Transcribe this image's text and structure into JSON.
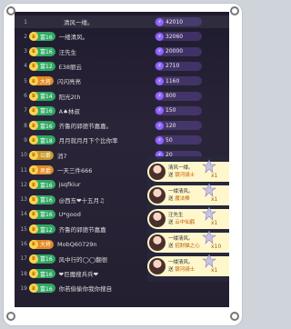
{
  "rows": [
    {
      "rank": "1",
      "badge": "",
      "name": "清风一缕。",
      "score": "42010",
      "type": "none"
    },
    {
      "rank": "2",
      "badge": "富16",
      "name": "一缕清风。",
      "score": "32060",
      "type": "green"
    },
    {
      "rank": "3",
      "badge": "富16",
      "name": "汪先生",
      "score": "20000",
      "type": "green"
    },
    {
      "rank": "4",
      "badge": "富12",
      "name": "E38丽云",
      "score": "2710",
      "type": "green"
    },
    {
      "rank": "5",
      "badge": "大将",
      "name": "闪闪亮亮",
      "score": "1160",
      "type": "orange"
    },
    {
      "rank": "6",
      "badge": "富14",
      "name": "阳光2th",
      "score": "800",
      "type": "green"
    },
    {
      "rank": "7",
      "badge": "富16",
      "name": "A♠林叔",
      "score": "150",
      "type": "green"
    },
    {
      "rank": "8",
      "badge": "富16",
      "name": "齐鲁的郭德节嘉嘉。",
      "score": "120",
      "type": "green"
    },
    {
      "rank": "9",
      "badge": "富18",
      "name": "月月就月月下个比你率",
      "score": "50",
      "type": "green"
    },
    {
      "rank": "10",
      "badge": "公爵",
      "name": "消7",
      "score": "20",
      "type": "gold"
    },
    {
      "rank": "11",
      "badge": "男爵",
      "name": "一天三件666",
      "score": "",
      "type": "orange"
    },
    {
      "rank": "12",
      "badge": "富16",
      "name": "jsqfkiur",
      "score": "",
      "type": "green"
    },
    {
      "rank": "13",
      "badge": "富16",
      "name": "@西东❤十五月♫",
      "score": "",
      "type": "green"
    },
    {
      "rank": "14",
      "badge": "富16",
      "name": "U*good",
      "score": "",
      "type": "green"
    },
    {
      "rank": "15",
      "badge": "富12",
      "name": "齐鲁的郭德节嘉嘉",
      "score": "",
      "type": "green"
    },
    {
      "rank": "16",
      "badge": "大将",
      "name": "MobQ60729n",
      "score": "",
      "type": "orange"
    },
    {
      "rank": "17",
      "badge": "富16",
      "name": "风中行的◯◯翻很",
      "score": "",
      "type": "green"
    },
    {
      "rank": "18",
      "badge": "富16",
      "name": "❤巨魔搜兵兵❤",
      "score": "",
      "type": "green"
    },
    {
      "rank": "19",
      "badge": "富16",
      "name": "你若偷偷你我你搜自",
      "score": "",
      "type": "green"
    }
  ],
  "gifts": [
    {
      "sender": "清风一缕。",
      "prefix": "送",
      "item": "银河骑士",
      "count": "x1"
    },
    {
      "sender": "一缕清风。",
      "prefix": "送",
      "item": "魔法棒",
      "count": "x1"
    },
    {
      "sender": "汪先生",
      "prefix": "送",
      "item": "云中仙鹤",
      "count": "x1"
    },
    {
      "sender": "一缕清风。",
      "prefix": "送",
      "item": "招财猫之心",
      "count": "x10"
    },
    {
      "sender": "一缕清风。",
      "prefix": "送",
      "item": "银河骑士",
      "count": "x1"
    }
  ]
}
